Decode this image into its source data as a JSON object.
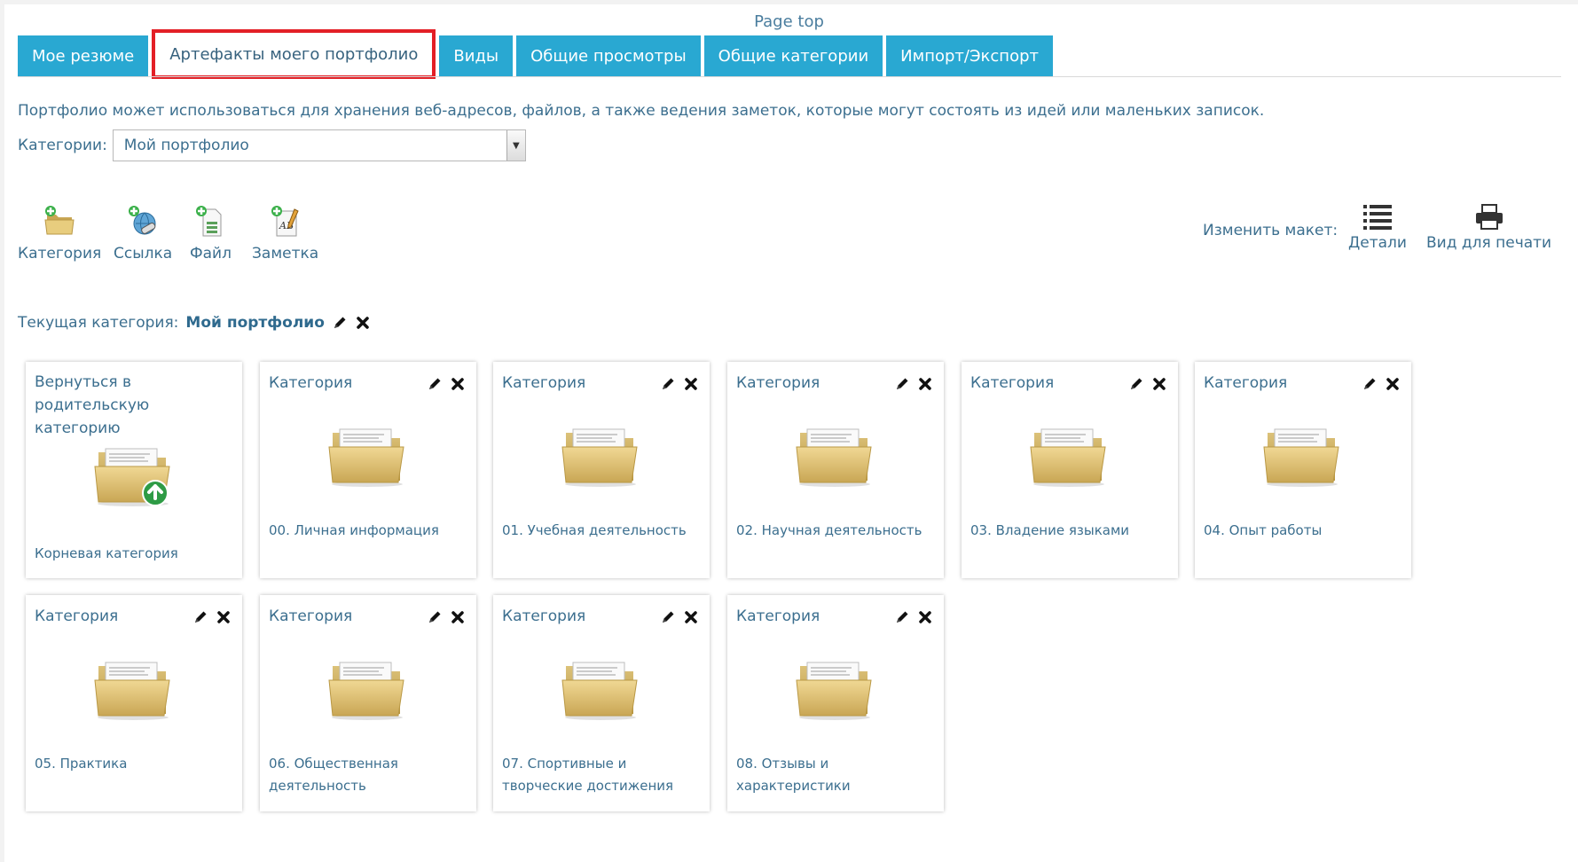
{
  "page_top": "Page top",
  "tabs": [
    {
      "label": "Мое резюме",
      "active": false
    },
    {
      "label": "Артефакты моего портфолио",
      "active": true
    },
    {
      "label": "Виды",
      "active": false
    },
    {
      "label": "Общие просмотры",
      "active": false
    },
    {
      "label": "Общие категории",
      "active": false
    },
    {
      "label": "Импорт/Экспорт",
      "active": false
    }
  ],
  "description": "Портфолио может использоваться для хранения веб-адресов, файлов, а также ведения заметок, которые могут состоять из идей или маленьких записок.",
  "categories_label": "Категории:",
  "categories_select": "Мой портфолио",
  "toolbar": [
    {
      "label": "Категория",
      "icon": "add-folder-icon"
    },
    {
      "label": "Ссылка",
      "icon": "add-link-icon"
    },
    {
      "label": "Файл",
      "icon": "add-file-icon"
    },
    {
      "label": "Заметка",
      "icon": "add-note-icon"
    }
  ],
  "layout": {
    "label": "Изменить макет:",
    "details": "Детали",
    "print": "Вид для печати"
  },
  "current": {
    "label": "Текущая категория:",
    "name": "Мой портфолио"
  },
  "back_card": {
    "title": "Вернуться в родительскую категорию",
    "caption": "Корневая категория"
  },
  "card_type_label": "Категория",
  "cards": [
    "00. Личная информация",
    "01. Учебная деятельность",
    "02. Научная деятельность",
    "03. Владение языками",
    "04. Опыт работы",
    "05. Практика",
    "06. Общественная деятельность",
    "07. Спортивные и творческие достижения",
    "08. Отзывы и характеристики"
  ],
  "colors": {
    "tab_bg": "#29a8d2",
    "active_border": "#e31f26",
    "text": "#3c6f8f"
  }
}
